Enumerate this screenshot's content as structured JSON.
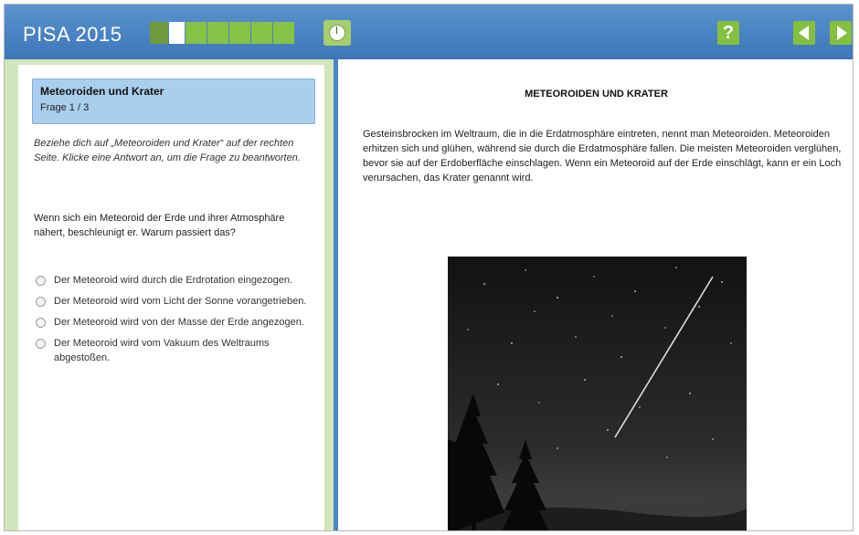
{
  "header": {
    "app_title": "PISA 2015",
    "help_label": "?",
    "progress": {
      "total_segments": 7,
      "current_index": 1
    }
  },
  "question_box": {
    "title": "Meteoroiden und Krater",
    "counter": "Frage 1 / 3"
  },
  "instruction": "Beziehe dich auf „Meteoroiden und Krater“ auf der rechten Seite. Klicke eine Antwort an, um die Frage zu beantworten.",
  "question": "Wenn sich ein Meteoroid der Erde und ihrer Atmosphäre nähert, beschleunigt er. Warum passiert das?",
  "options": [
    {
      "label": "Der Meteoroid wird durch die Erdrotation eingezogen."
    },
    {
      "label": "Der Meteoroid wird vom Licht der Sonne vorangetrieben."
    },
    {
      "label": "Der Meteoroid wird von der Masse der Erde angezogen."
    },
    {
      "label": "Der Meteoroid wird vom Vakuum des Weltraums abgestoßen."
    }
  ],
  "article": {
    "title": "METEOROIDEN UND KRATER",
    "body": "Gesteinsbrocken im Weltraum, die in die Erdatmosphäre eintreten, nennt man Meteoroiden. Meteoroiden erhitzen sich und glühen, während sie durch die Erdatmosphäre fallen. Die meisten Meteoroiden verglühen, bevor sie auf der Erdoberfläche einschlagen. Wenn ein Meteoroid auf der Erde einschlägt, kann er ein Loch verursachen, das Krater genannt wird."
  },
  "colors": {
    "header_blue": "#4a84c4",
    "accent_green": "#86c243",
    "question_box_blue": "#a9cfee",
    "panel_green": "#d1e6bd"
  }
}
